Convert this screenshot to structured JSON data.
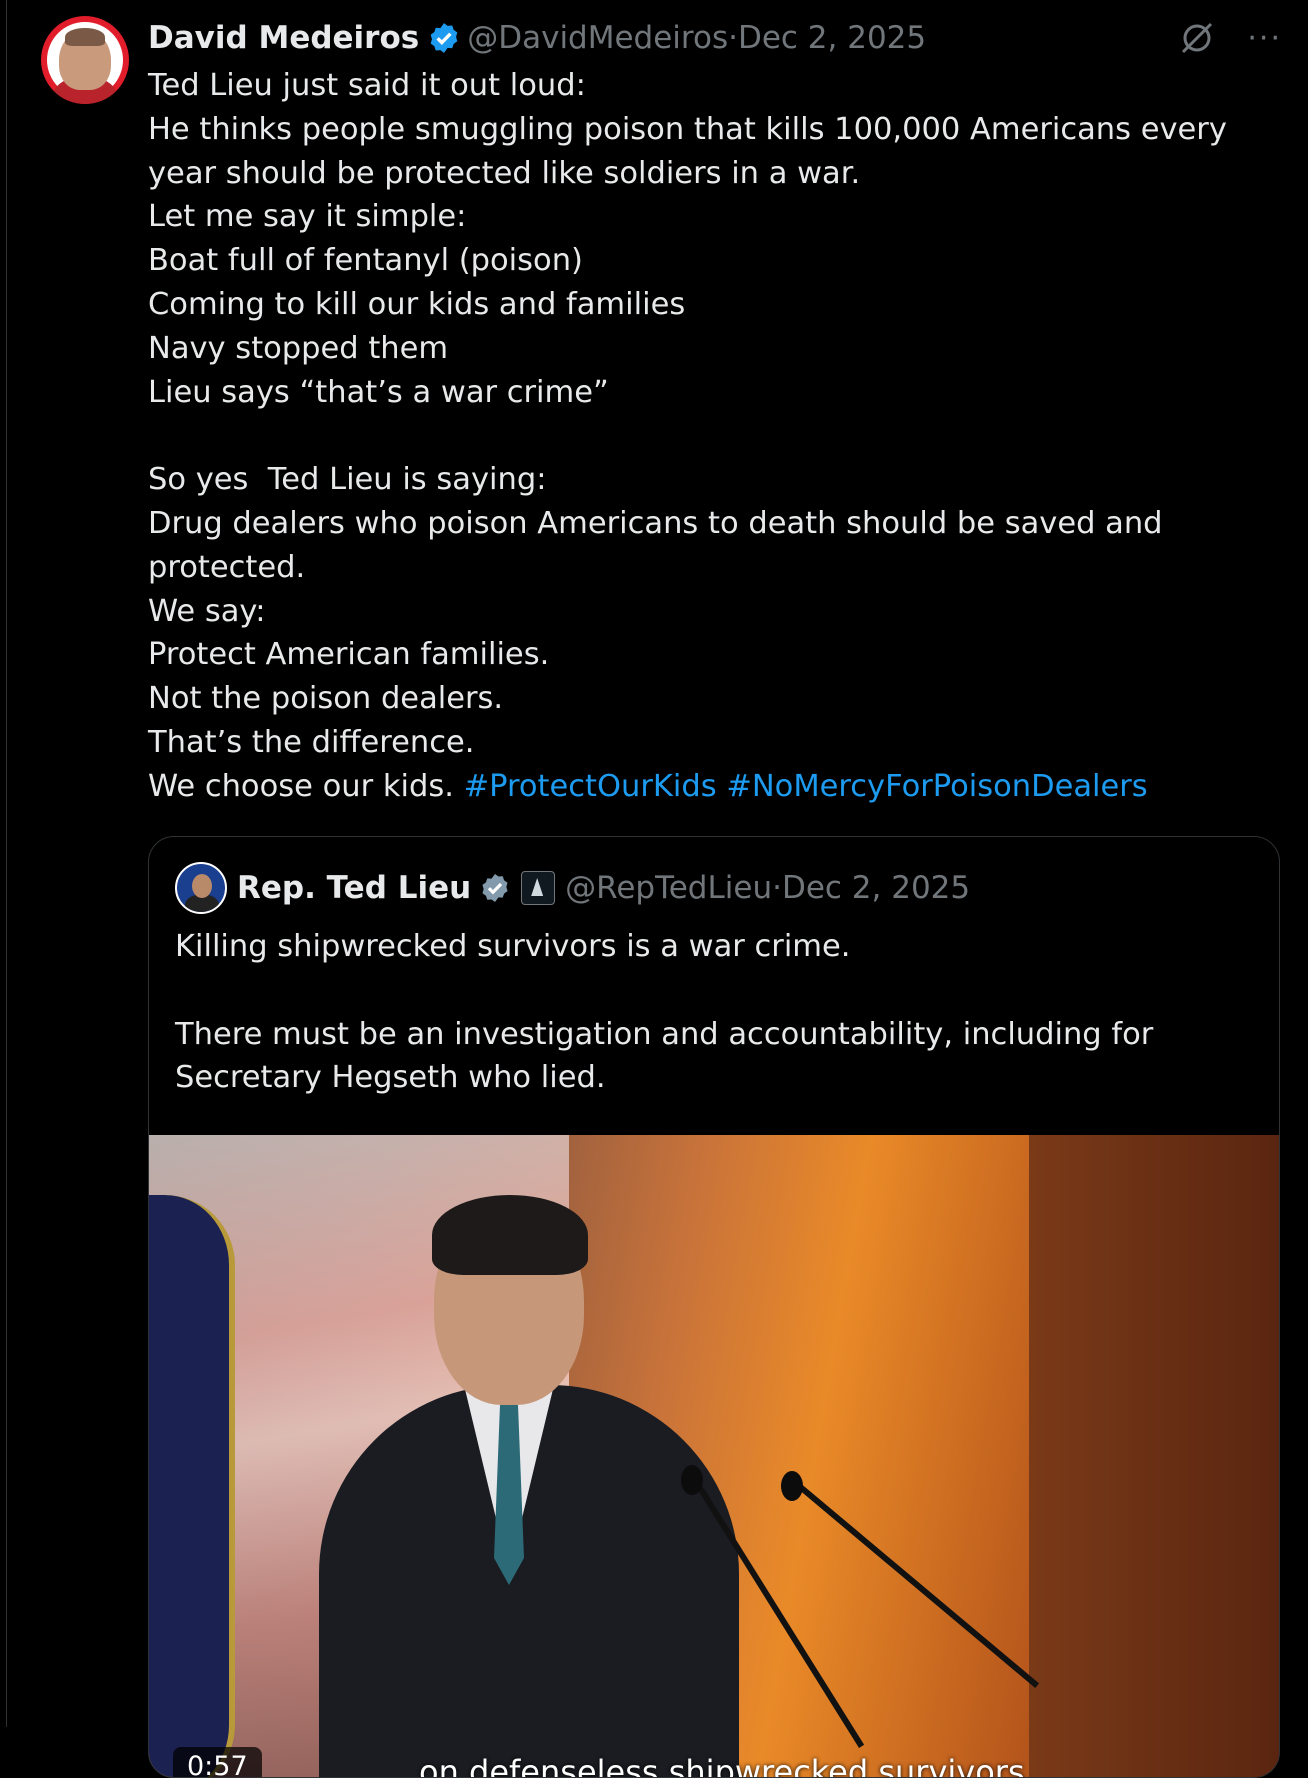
{
  "post": {
    "author_name": "David Medeiros",
    "author_handle": "@DavidMedeiros",
    "separator": " · ",
    "date": "Dec 2, 2025",
    "more_label": "···",
    "text": "Ted Lieu just said it out loud:\nHe thinks people smuggling poison that kills 100,000 Americans every year should be protected like soldiers in a war.\nLet me say it simple:\nBoat full of fentanyl (poison)\nComing to kill our kids and families\nNavy stopped them\nLieu says “that’s a war crime”\n\nSo yes  Ted Lieu is saying:\nDrug dealers who poison Americans to death should be saved and protected.\nWe say:\nProtect American families.\nNot the poison dealers.\nThat’s the difference.\nWe choose our kids. ",
    "hashtags": [
      "#ProtectOurKids",
      "#NoMercyForPoisonDealers"
    ]
  },
  "quoted": {
    "author_name": "Rep. Ted Lieu",
    "author_handle": "@RepTedLieu",
    "separator": " · ",
    "date": "Dec 2, 2025",
    "text": "Killing shipwrecked survivors is a war crime.\n\nThere must be an investigation and accountability, including for Secretary Hegseth who lied.",
    "video": {
      "duration": "0:57",
      "caption": "on defenseless shipwrecked survivors"
    }
  },
  "colors": {
    "background": "#000000",
    "text": "#e7e9ea",
    "muted": "#71767b",
    "link": "#1d9bf0",
    "verified": "#1d9bf0",
    "verified_gov": "#829aab"
  },
  "icons": [
    "avatar",
    "verified-badge-icon",
    "grok-icon",
    "more-icon",
    "government-badge-icon"
  ]
}
